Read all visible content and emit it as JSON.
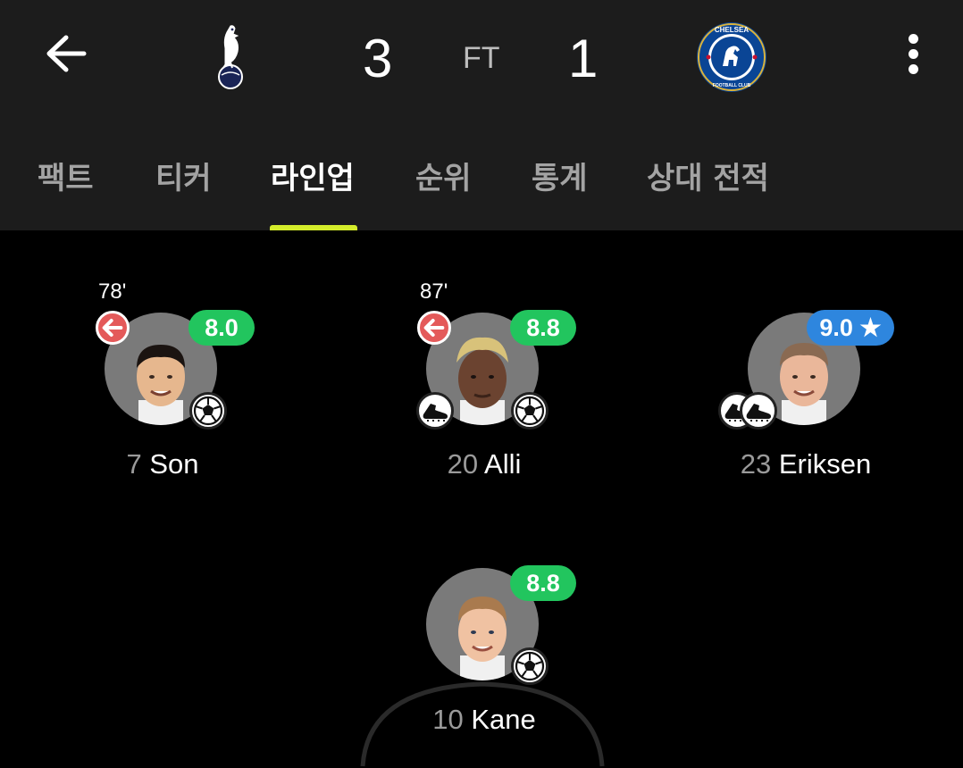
{
  "match": {
    "home_score": "3",
    "status": "FT",
    "away_score": "1",
    "home_crest_icon": "tottenham-crest-icon",
    "away_crest_icon": "chelsea-crest-icon",
    "away_crest_text_top": "CHELSEA",
    "away_crest_text_bottom": "FOOTBALL CLUB"
  },
  "tabs": [
    {
      "label": "팩트"
    },
    {
      "label": "티커"
    },
    {
      "label": "라인업",
      "active": true
    },
    {
      "label": "순위"
    },
    {
      "label": "통계"
    },
    {
      "label": "상대 전적"
    }
  ],
  "players": [
    {
      "number": "7",
      "name": "Son",
      "sub_minute": "78'",
      "rating": "8.0",
      "rating_color": "#22c55e",
      "events": [
        "goal-icon"
      ]
    },
    {
      "number": "20",
      "name": "Alli",
      "sub_minute": "87'",
      "rating": "8.8",
      "rating_color": "#22c55e",
      "events": [
        "assist-boot-icon",
        "goal-icon"
      ]
    },
    {
      "number": "23",
      "name": "Eriksen",
      "sub_minute": "",
      "rating": "9.0",
      "rating_star": "★",
      "rating_color": "#2e86de",
      "events": [
        "assist-boot-icon",
        "assist-boot-icon"
      ]
    },
    {
      "number": "10",
      "name": "Kane",
      "sub_minute": "",
      "rating": "8.8",
      "rating_color": "#22c55e",
      "events": [
        "goal-icon"
      ]
    }
  ],
  "colors": {
    "header_bg": "#1c1c1c",
    "tab_indicator": "#d4ec2b",
    "sub_off": "#e45a5a",
    "rating_green": "#22c55e",
    "rating_blue": "#2e86de"
  }
}
